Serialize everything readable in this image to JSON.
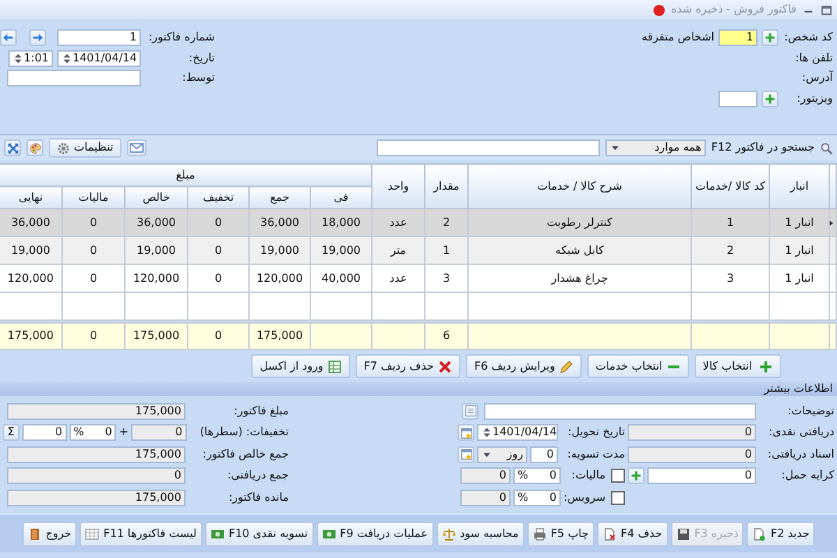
{
  "window": {
    "title": "فاکتور فروش - ذخیره شده"
  },
  "header": {
    "person": {
      "label": "کد شخص:",
      "value": "1",
      "name": "اشخاص متفرقه"
    },
    "phones": {
      "label": "تلفن ها:"
    },
    "address": {
      "label": "آدرس:"
    },
    "visitor": {
      "label": "ویزیتور:"
    },
    "invoice_number": {
      "label": "شماره فاکتور:",
      "value": "1"
    },
    "date": {
      "label": "تاریخ:",
      "value": "1401/04/14",
      "time": "1:01"
    },
    "by": {
      "label": "توسط:"
    }
  },
  "toolbar": {
    "search_label": "جستجو در فاکتور F12",
    "filter": "همه موارد",
    "settings": "تنظیمات"
  },
  "table": {
    "columns": [
      "انبار",
      "کد کالا /خدمات",
      "شرح کالا / خدمات",
      "مقدار",
      "واحد"
    ],
    "amount_group": {
      "label": "مبلغ",
      "columns": [
        "فی",
        "جمع",
        "تخفیف",
        "خالص",
        "مالیات",
        "نهایی"
      ]
    },
    "rows": [
      {
        "selected": true,
        "cells": [
          "انبار 1",
          "1",
          "کنترلر رطوبت",
          "2",
          "عدد",
          "18,000",
          "36,000",
          "0",
          "36,000",
          "0",
          "36,000"
        ]
      },
      {
        "selected": false,
        "cells": [
          "انبار 1",
          "2",
          "کابل شبکه",
          "1",
          "متر",
          "19,000",
          "19,000",
          "0",
          "19,000",
          "0",
          "19,000"
        ]
      },
      {
        "selected": false,
        "cells": [
          "انبار 1",
          "3",
          "چراغ هشدار",
          "3",
          "عدد",
          "40,000",
          "120,000",
          "0",
          "120,000",
          "0",
          "120,000"
        ]
      }
    ],
    "totals": {
      "quantity": "6",
      "sum": "175,000",
      "discount": "0",
      "net": "175,000",
      "tax": "0",
      "final": "175,000"
    }
  },
  "row_buttons": [
    {
      "label": "انتخاب کالا",
      "kind": "plus"
    },
    {
      "label": "انتخاب خدمات",
      "kind": "minus"
    },
    {
      "label": "ویرایش ردیف F6",
      "kind": "pencil"
    },
    {
      "label": "حذف ردیف F7",
      "kind": "cross"
    },
    {
      "label": "ورود از اکسل",
      "kind": "excel"
    }
  ],
  "more_info": {
    "title": "اطلاعات بیشتر",
    "description": {
      "label": "توضیحات:"
    },
    "cash": {
      "label": "دریافتی نقدی:",
      "value": "0"
    },
    "cheques": {
      "label": "اسناد دریافتی:",
      "value": "0"
    },
    "freight": {
      "label": "کرایه حمل:",
      "value": "0"
    },
    "delivery_date": {
      "label": "تاریخ تحویل:",
      "value": "1401/04/14"
    },
    "settlement": {
      "label": "مدت تسویه:",
      "value": "0",
      "unit": "روز"
    },
    "tax": {
      "label": "مالیات:",
      "checked": false,
      "percent": "0",
      "percent_sign": "%",
      "amount": "0"
    },
    "service": {
      "label": "سرویس:",
      "checked": false,
      "percent": "0",
      "percent_sign": "%",
      "amount": "0"
    },
    "invoice_amount": {
      "label": "مبلغ فاکتور:",
      "value": "175,000"
    },
    "discounts": {
      "label": "تخفیفات: (سطرها)",
      "rows_value": "0",
      "plus": "+",
      "percent": "0",
      "percent_sign": "%",
      "amount": "0",
      "sum_button": "Σ"
    },
    "net_total": {
      "label": "جمع خالص فاکتور:",
      "value": "175,000"
    },
    "received_total": {
      "label": "جمع دریافتی:",
      "value": "0"
    },
    "balance": {
      "label": "مانده فاکتور:",
      "value": "175,000"
    }
  },
  "actions": [
    {
      "label": "جدید F2",
      "kind": "new",
      "disabled": false
    },
    {
      "label": "ذخیره F3",
      "kind": "save",
      "disabled": true
    },
    {
      "label": "حذف F4",
      "kind": "delete",
      "disabled": false
    },
    {
      "label": "چاپ F5",
      "kind": "print",
      "disabled": false
    },
    {
      "label": "محاسبه سود",
      "kind": "scale",
      "disabled": false
    },
    {
      "label": "عملیات دریافت F9",
      "kind": "cash",
      "disabled": false
    },
    {
      "label": "تسویه نقدی F10",
      "kind": "cash",
      "disabled": false
    },
    {
      "label": "لیست فاکتورها F11",
      "kind": "grid",
      "disabled": false
    },
    {
      "label": "خروج",
      "kind": "door",
      "disabled": false
    }
  ]
}
